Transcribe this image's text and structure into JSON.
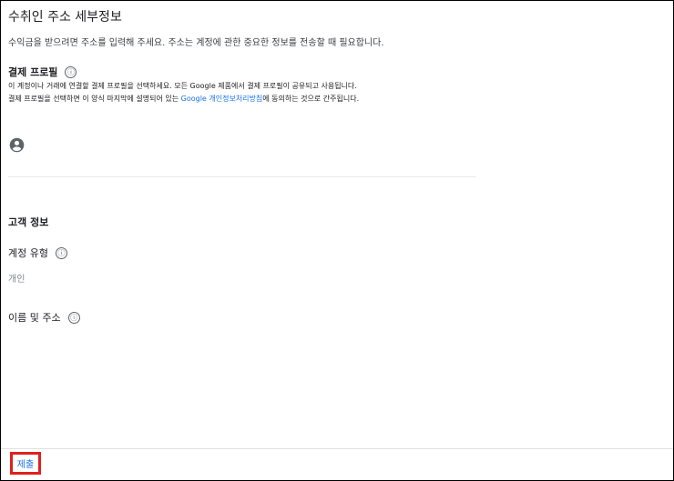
{
  "header": {
    "title": "수취인 주소 세부정보",
    "subtitle": "수익금을 받으려면 주소를 입력해 주세요. 주소는 계정에 관한 중요한 정보를 전송할 때 필요합니다."
  },
  "payment_profile": {
    "heading": "결제 프로필",
    "info_icon": "ⓘ",
    "desc_line1": "이 계정이나 거래에 연결할 결제 프로필을 선택하세요. 모든 Google 제품에서 결제 프로필이 공유되고 사용됩니다.",
    "desc_line2_before": "결제 프로필을 선택하면 이 양식 마지막에 설명되어 있는 ",
    "desc_line2_link": "Google 개인정보처리방침",
    "desc_line2_after": "에 동의하는 것으로 간주됩니다.",
    "account_icon": "account-circle-icon"
  },
  "customer_info": {
    "heading": "고객 정보",
    "account_type_label": "계정 유형",
    "account_type_value": "개인",
    "name_address_label": "이름 및 주소",
    "info_icon": "ⓘ"
  },
  "footer": {
    "submit_label": "제출",
    "highlight_color": "#e0201b",
    "link_color": "#1a73e8"
  }
}
